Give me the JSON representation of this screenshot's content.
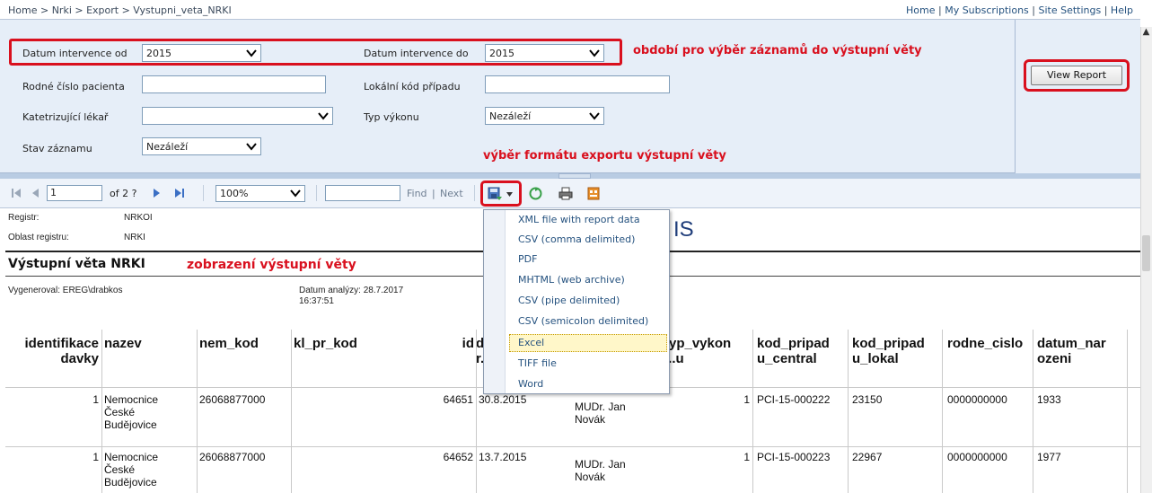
{
  "topbar": {
    "breadcrumb": "Home > Nrki > Export > Vystupni_veta_NRKI",
    "links": [
      "Home",
      "My Subscriptions",
      "Site Settings",
      "Help"
    ]
  },
  "params": {
    "date_from_label": "Datum intervence od",
    "date_from_value": "2015",
    "date_to_label": "Datum intervence do",
    "date_to_value": "2015",
    "birth_number_label": "Rodné číslo pacienta",
    "local_case_label": "Lokální kód případu",
    "doctor_label": "Katetrizující lékař",
    "doctor_value": "",
    "procedure_type_label": "Typ výkonu",
    "procedure_type_value": "Nezáleží",
    "record_state_label": "Stav záznamu",
    "record_state_value": "Nezáleží",
    "view_report_label": "View Report"
  },
  "annotations": {
    "period": "období pro výběr záznamů do výstupní věty",
    "export_format": "výběr formátu exportu výstupní věty",
    "view_output": "zobrazení výstupní věty"
  },
  "toolbar": {
    "page_value": "1",
    "page_of": "of 2 ?",
    "zoom_value": "100%",
    "find_label": "Find",
    "next_label": "Next",
    "separator": "|"
  },
  "export_menu": {
    "items": [
      "XML file with report data",
      "CSV (comma delimited)",
      "PDF",
      "MHTML (web archive)",
      "CSV (pipe delimited)",
      "CSV (semicolon delimited)",
      "Excel",
      "TIFF file",
      "Word"
    ],
    "highlighted": "Excel"
  },
  "report": {
    "registry_label": "Registr:",
    "registry_value": "NRKOI",
    "area_label": "Oblast registru:",
    "area_value": "NRKI",
    "logo_text": "IS",
    "title": "Výstupní věta NRKI",
    "generated_by": "Vygeneroval: EREG\\drabkos",
    "analysis_date_label": "Datum analýzy: 28.7.2017",
    "analysis_time": "16:37:51",
    "columns": [
      "identifikace davky",
      "nazev",
      "nem_kod",
      "kl_pr_kod",
      "id",
      "d... r...",
      "...",
      "typ_vykon ...u",
      "kod_pripad u_central",
      "kod_pripad u_lokal",
      "rodne_cislo",
      "datum_nar ozeni"
    ],
    "rows": [
      {
        "davka": "1",
        "nazev": [
          "Nemocnice",
          "České",
          "Budějovice"
        ],
        "nem_kod": "26068877000",
        "kl_pr_kod": "",
        "id": "64651",
        "datum": "30.8.2015",
        "lekar": [
          "MUDr. Jan",
          "Novák"
        ],
        "typ_vykon": "1",
        "central": "PCI-15-000222",
        "lokal": "23150",
        "rodne_cislo": "0000000000",
        "narozeni": "1933"
      },
      {
        "davka": "1",
        "nazev": [
          "Nemocnice",
          "České",
          "Budějovice"
        ],
        "nem_kod": "26068877000",
        "kl_pr_kod": "",
        "id": "64652",
        "datum": "13.7.2015",
        "lekar": [
          "MUDr. Jan",
          "Novák"
        ],
        "typ_vykon": "1",
        "central": "PCI-15-000223",
        "lokal": "22967",
        "rodne_cislo": "0000000000",
        "narozeni": "1977"
      }
    ]
  },
  "icons": {
    "first_page": "first-page-icon",
    "prev_page": "prev-page-icon",
    "next_page": "next-page-icon",
    "last_page": "last-page-icon",
    "export": "export-icon",
    "refresh": "refresh-icon",
    "print": "print-icon",
    "data_feed": "data-feed-icon"
  },
  "colors": {
    "annotation_red": "#d9101e",
    "param_bg": "#e6eef8",
    "link_blue": "#25527f"
  }
}
